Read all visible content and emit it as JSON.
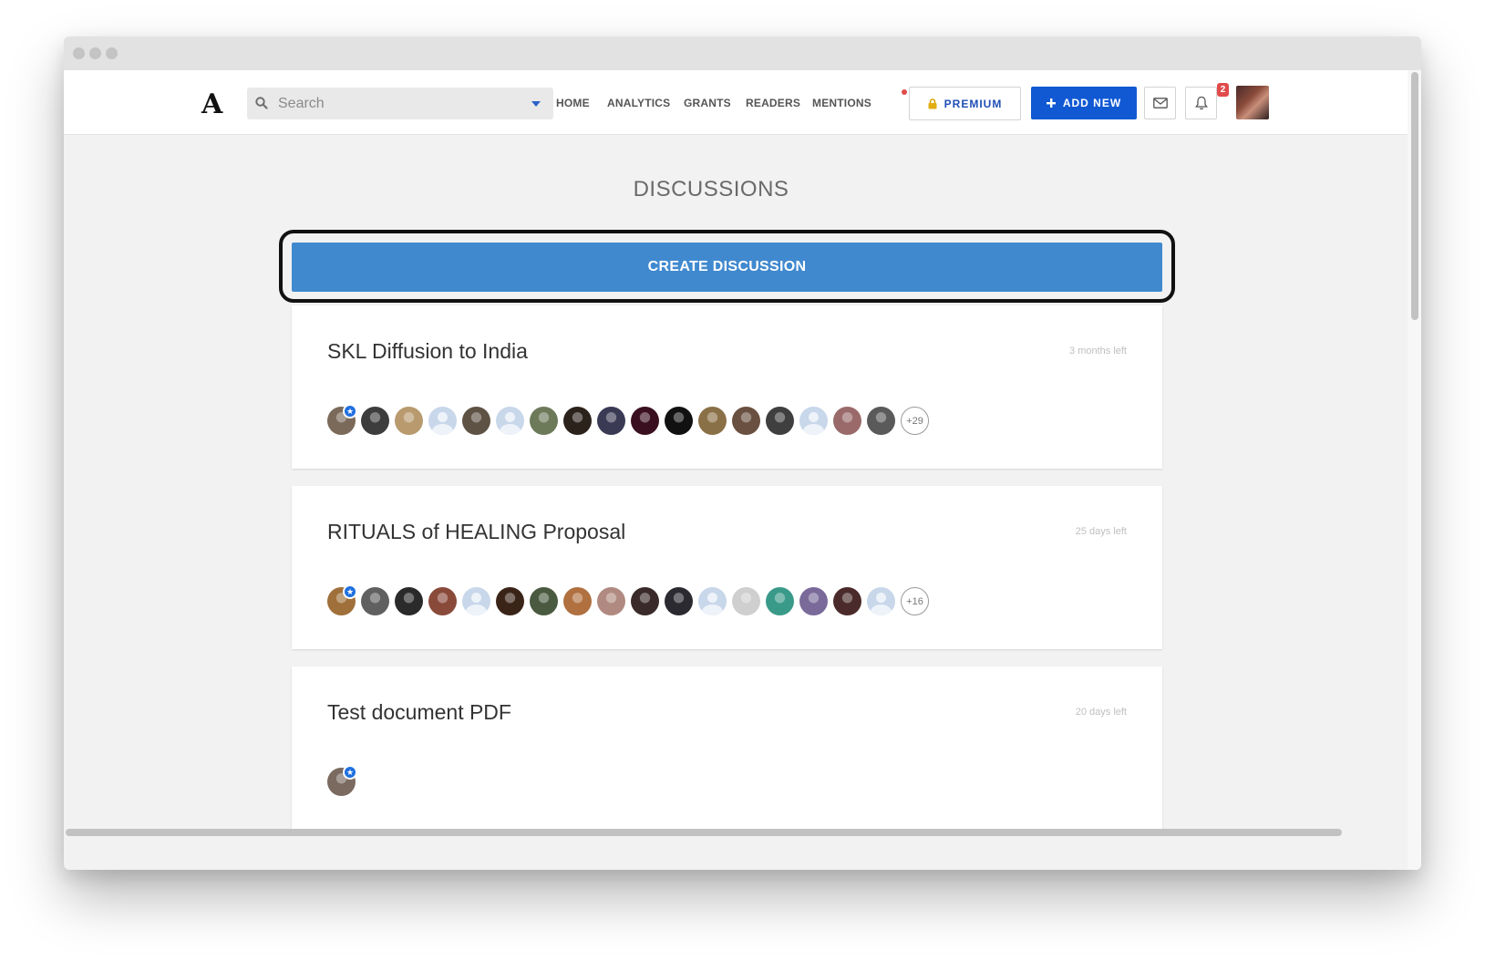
{
  "nav": {
    "logo": "A",
    "search_placeholder": "Search",
    "links": [
      "HOME",
      "ANALYTICS",
      "GRANTS",
      "READERS",
      "MENTIONS"
    ],
    "premium_label": "PREMIUM",
    "add_new_label": "ADD NEW",
    "notification_count": "2"
  },
  "page": {
    "title": "DISCUSSIONS",
    "create_label": "CREATE DISCUSSION"
  },
  "discussions": [
    {
      "title": "SKL Diffusion to India",
      "time_left": "3 months left",
      "more_count": "+29",
      "avatar_colors": [
        "#7b6a5a",
        "#3d3d3d",
        "#b89a6e",
        "ph",
        "#5e5245",
        "ph",
        "#6c7a5a",
        "#2c221c",
        "#3b3a55",
        "#3a1020",
        "#111111",
        "#8a7046",
        "#6a5040",
        "#3f3f3f",
        "ph",
        "#9a6a6a",
        "#5a5a5a"
      ]
    },
    {
      "title": "RITUALS of HEALING Proposal",
      "time_left": "25 days left",
      "more_count": "+16",
      "avatar_colors": [
        "#a0703a",
        "#606060",
        "#2a2a2a",
        "#8a4a3a",
        "ph",
        "#3a2418",
        "#4a5a40",
        "#b07040",
        "#b08a80",
        "#3a2a2a",
        "#2a2a30",
        "ph",
        "#cfcfcf",
        "#3a9a8a",
        "#7a6a9a",
        "#4a2a2a",
        "ph"
      ]
    },
    {
      "title": "Test document PDF",
      "time_left": "20 days left",
      "more_count": "",
      "avatar_colors": [
        "#7a6a60"
      ]
    }
  ]
}
